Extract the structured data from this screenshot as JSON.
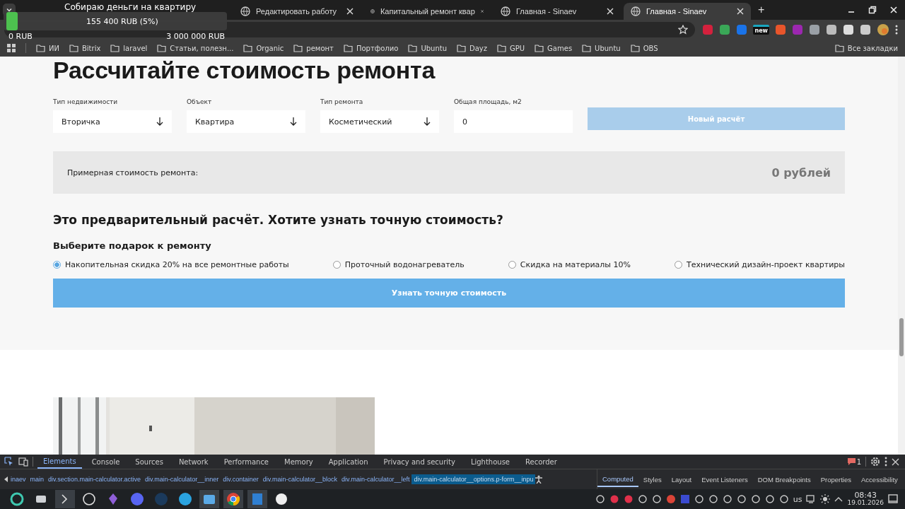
{
  "browser": {
    "tabs": [
      {
        "title": "Редактировать работу",
        "selected": false
      },
      {
        "title": "Капитальный ремонт квар",
        "selected": false
      },
      {
        "title": "Главная - Sinaev",
        "selected": false
      },
      {
        "title": "Главная - Sinaev",
        "selected": true
      }
    ],
    "new_tab": "+",
    "extension_badge": "new",
    "all_bookmarks": "Все закладки",
    "bookmarks": [
      "ИИ",
      "Bitrix",
      "laravel",
      "Статьи, полезн...",
      "Organic",
      "ремонт",
      "Портфолио",
      "Ubuntu",
      "Dayz",
      "GPU",
      "Games",
      "Ubuntu",
      "OBS"
    ]
  },
  "fundraiser": {
    "title": "Собираю деньги на квартиру",
    "level": 0.05,
    "amount": "155 400 RUB (5%)",
    "min": "0 RUB",
    "max": "3 000 000 RUB"
  },
  "calculator": {
    "title": "Рассчитайте стоимость ремонта",
    "fields": [
      {
        "kind": "select",
        "label": "Тип недвижимости",
        "value": "Вторичка"
      },
      {
        "kind": "select",
        "label": "Объект",
        "value": "Квартира"
      },
      {
        "kind": "select",
        "label": "Тип ремонта",
        "value": "Косметический"
      },
      {
        "kind": "input",
        "label": "Общая площадь, м2",
        "value": "0"
      }
    ],
    "reset_button": "Новый расчёт",
    "result_label": "Примерная стоимость ремонта:",
    "result_value": "0 рублей",
    "question": "Это предварительный расчёт. Хотите узнать точную стоимость?",
    "gift_title": "Выберите подарок к ремонту",
    "gifts": [
      {
        "label": "Накопительная скидка 20% на все ремонтные работы",
        "selected": true
      },
      {
        "label": "Проточный водонагреватель",
        "selected": false
      },
      {
        "label": "Скидка на материалы 10%",
        "selected": false
      },
      {
        "label": "Технический дизайн-проект квартиры",
        "selected": false
      }
    ],
    "submit_button": "Узнать точную стоимость"
  },
  "devtools": {
    "tabs": [
      {
        "label": "Elements",
        "selected": true
      },
      {
        "label": "Console",
        "selected": false
      },
      {
        "label": "Sources",
        "selected": false
      },
      {
        "label": "Network",
        "selected": false
      },
      {
        "label": "Performance",
        "selected": false
      },
      {
        "label": "Memory",
        "selected": false
      },
      {
        "label": "Application",
        "selected": false
      },
      {
        "label": "Privacy and security",
        "selected": false
      },
      {
        "label": "Lighthouse",
        "selected": false
      },
      {
        "label": "Recorder",
        "selected": false
      }
    ],
    "issues_count": "1",
    "breadcrumbs": [
      {
        "label": "inaev",
        "selected": false
      },
      {
        "label": "main",
        "selected": false
      },
      {
        "label": "div.section.main-calculator.active",
        "selected": false
      },
      {
        "label": "div.main-calculator__inner",
        "selected": false
      },
      {
        "label": "div.container",
        "selected": false
      },
      {
        "label": "div.main-calculator__block",
        "selected": false
      },
      {
        "label": "div.main-calculator__left",
        "selected": false
      },
      {
        "label": "div.main-calculator__options.p-form__inpu",
        "selected": true
      }
    ],
    "side_tabs": [
      {
        "label": "Computed",
        "selected": true
      },
      {
        "label": "Styles",
        "selected": false
      },
      {
        "label": "Layout",
        "selected": false
      },
      {
        "label": "Event Listeners",
        "selected": false
      },
      {
        "label": "DOM Breakpoints",
        "selected": false
      },
      {
        "label": "Properties",
        "selected": false
      },
      {
        "label": "Accessibility",
        "selected": false
      }
    ]
  },
  "taskbar": {
    "keyboard_layout": "us",
    "time": "08:43",
    "date": "19.01.2026"
  }
}
